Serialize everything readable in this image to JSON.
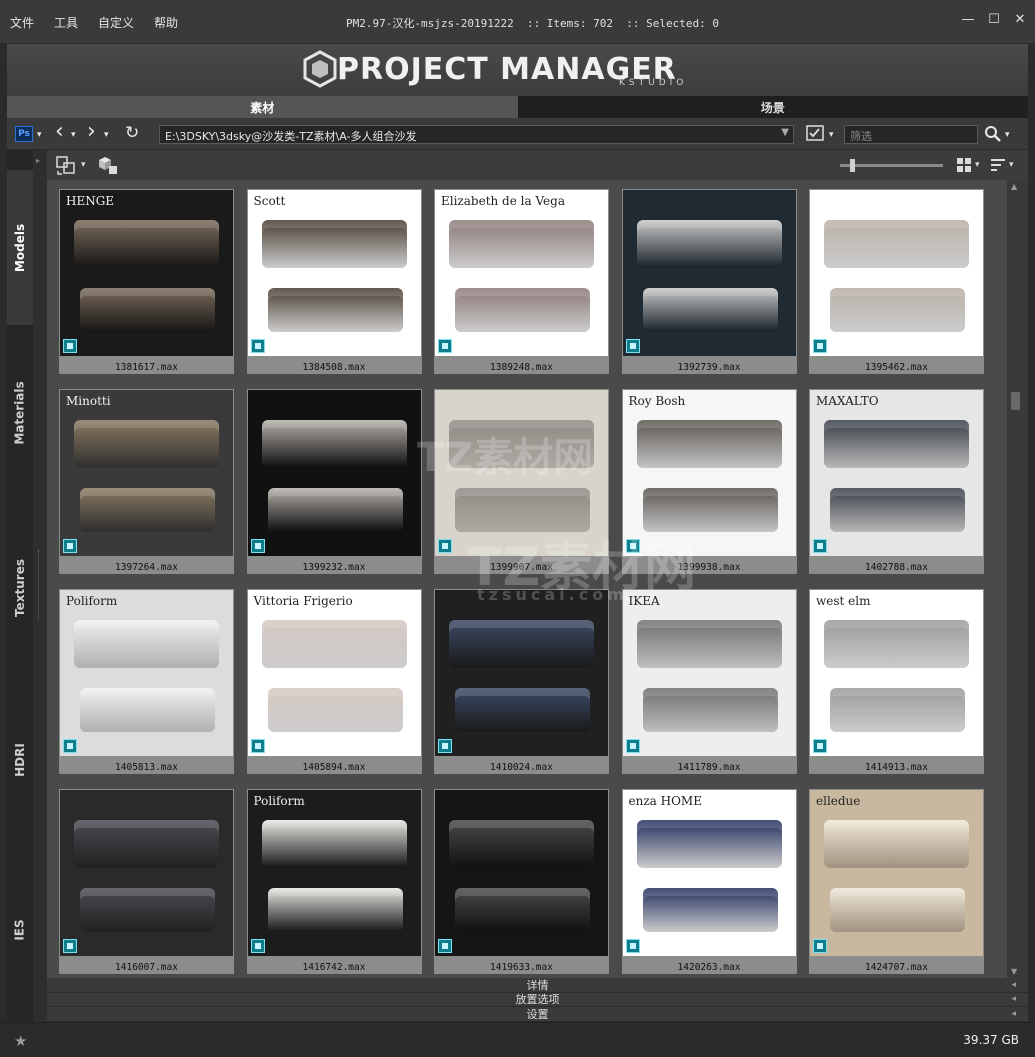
{
  "menu": {
    "items": [
      "文件",
      "工具",
      "自定义",
      "帮助"
    ]
  },
  "title_info": "PM2.97-汉化-msjzs-20191222  :: Items: 702  :: Selected: 0",
  "window_controls": {
    "minimize": "—",
    "maximize": "☐",
    "close": "✕"
  },
  "logo": {
    "main": "PROJECT MANAGER",
    "sub": "KSTUDIO"
  },
  "tabs": [
    {
      "label": "素材",
      "active": true
    },
    {
      "label": "场景",
      "active": false
    }
  ],
  "toolbar": {
    "ps_badge": "Ps",
    "back_icon": "‹",
    "forward_icon": "›",
    "refresh_icon": "↻",
    "path": "E:\\3DSKY\\3dsky@沙发类-TZ素材\\A-多人组合沙发",
    "filter_placeholder": "筛选"
  },
  "sidebar": {
    "tabs": [
      {
        "label": "Models",
        "active": true
      },
      {
        "label": "Materials",
        "active": false
      },
      {
        "label": "Textures",
        "active": false
      },
      {
        "label": "HDRI",
        "active": false
      },
      {
        "label": "IES",
        "active": false
      }
    ]
  },
  "slider": {
    "value": 0.1
  },
  "items": [
    {
      "name": "1381617.max",
      "brand": "HENGE",
      "bg": "#1a1a1a",
      "sofa": "#7b6b5b"
    },
    {
      "name": "1384508.max",
      "brand": "Scott",
      "bg": "#ffffff",
      "sofa": "#4a3e33"
    },
    {
      "name": "1389248.max",
      "brand": "Elizabeth de la Vega",
      "bg": "#ffffff",
      "sofa": "#8b7a78"
    },
    {
      "name": "1392739.max",
      "brand": "",
      "bg": "#1f2a33",
      "sofa": "#c8c8c8"
    },
    {
      "name": "1395462.max",
      "brand": "",
      "bg": "#ffffff",
      "sofa": "#b8b0a6"
    },
    {
      "name": "1397264.max",
      "brand": "Minotti",
      "bg": "#3a3a3a",
      "sofa": "#8a7a62"
    },
    {
      "name": "1399232.max",
      "brand": "",
      "bg": "#111111",
      "sofa": "#b5b0aa"
    },
    {
      "name": "1399907.max",
      "brand": "",
      "bg": "#d8d4cc",
      "sofa": "#8e8a84"
    },
    {
      "name": "1399938.max",
      "brand": "Roy Bosh",
      "bg": "#f6f6f6",
      "sofa": "#5a5550"
    },
    {
      "name": "1402788.max",
      "brand": "MAXALTO",
      "bg": "#e6e6e6",
      "sofa": "#3a4048"
    },
    {
      "name": "1405813.max",
      "brand": "Poliform",
      "bg": "#dcdcdc",
      "sofa": "#efefef"
    },
    {
      "name": "1405894.max",
      "brand": "Vittoria Frigerio",
      "bg": "#ffffff",
      "sofa": "#d4c8c2"
    },
    {
      "name": "1410024.max",
      "brand": "",
      "bg": "#202020",
      "sofa": "#3c4a66"
    },
    {
      "name": "1411789.max",
      "brand": "IKEA",
      "bg": "#eeeeee",
      "sofa": "#6e7070"
    },
    {
      "name": "1414913.max",
      "brand": "west elm",
      "bg": "#ffffff",
      "sofa": "#9a9a9a"
    },
    {
      "name": "1416007.max",
      "brand": "",
      "bg": "#2a2a2a",
      "sofa": "#4a4a52"
    },
    {
      "name": "1416742.max",
      "brand": "Poliform",
      "bg": "#1c1c1c",
      "sofa": "#e6e6e2"
    },
    {
      "name": "1419633.max",
      "brand": "",
      "bg": "#151515",
      "sofa": "#4a4a4a"
    },
    {
      "name": "1420263.max",
      "brand": "enza HOME",
      "bg": "#ffffff",
      "sofa": "#23305e"
    },
    {
      "name": "1424707.max",
      "brand": "elledue",
      "bg": "#c8b8a0",
      "sofa": "#efe6d6"
    }
  ],
  "bottom_panels": [
    "详情",
    "放置选项",
    "设置"
  ],
  "status": {
    "disk": "39.37 GB",
    "star": "★"
  },
  "watermark": {
    "text": "TZ素材网",
    "url": "tzsucai.com"
  }
}
